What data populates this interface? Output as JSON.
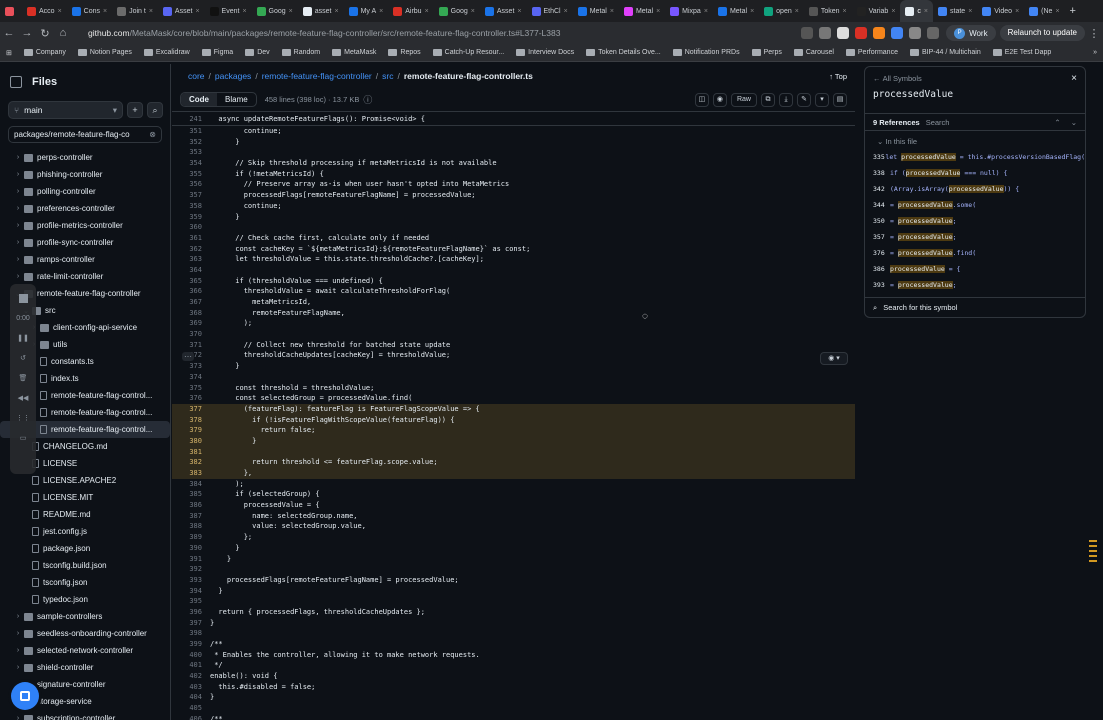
{
  "browser": {
    "tabs": [
      {
        "label": "",
        "color": "#e9505a"
      },
      {
        "label": "Acco",
        "color": "#d93025"
      },
      {
        "label": "Cons",
        "color": "#1a73e8"
      },
      {
        "label": "Join t",
        "color": "#6b6b6b"
      },
      {
        "label": "Asset",
        "color": "#5865f2"
      },
      {
        "label": "Event",
        "color": "#111"
      },
      {
        "label": "Goog",
        "color": "#34a853"
      },
      {
        "label": "asset",
        "color": "#e6edf3"
      },
      {
        "label": "My A",
        "color": "#1a73e8"
      },
      {
        "label": "Airbu",
        "color": "#d93025"
      },
      {
        "label": "Goog",
        "color": "#34a853"
      },
      {
        "label": "Asset",
        "color": "#1a73e8"
      },
      {
        "label": "EthCl",
        "color": "#5865f2"
      },
      {
        "label": "Metal",
        "color": "#1a73e8"
      },
      {
        "label": "Metal",
        "color": "#e040fb"
      },
      {
        "label": "Mixpa",
        "color": "#7856ff"
      },
      {
        "label": "Metal",
        "color": "#1a73e8"
      },
      {
        "label": "open",
        "color": "#10a37f"
      },
      {
        "label": "Token",
        "color": "#555"
      },
      {
        "label": "Variab",
        "color": "#222"
      },
      {
        "label": "c",
        "color": "#e6edf3",
        "active": true
      },
      {
        "label": "state",
        "color": "#4285f4"
      },
      {
        "label": "Video",
        "color": "#4285f4"
      },
      {
        "label": "(Ne",
        "color": "#4285f4"
      }
    ],
    "new_tab": "+",
    "url_host": "github.com",
    "url_path": "/MetaMask/core/blob/main/packages/remote-feature-flag-controller/src/remote-feature-flag-controller.ts#L377-L383",
    "profile_label": "Work",
    "profile_initial": "P",
    "relaunch_label": "Relaunch to update",
    "bookmarks": [
      "Company",
      "Notion Pages",
      "Excalidraw",
      "Figma",
      "Dev",
      "Random",
      "MetaMask",
      "Repos",
      "Catch-Up Resour...",
      "Interview Docs",
      "Token Details Ove...",
      "Notification PRDs",
      "Perps",
      "Carousel",
      "Performance",
      "BIP-44 / Multichain",
      "E2E Test Dapp"
    ],
    "bookmarks_more": "»"
  },
  "sidebar": {
    "title": "Files",
    "branch": "main",
    "filter_value": "packages/remote-feature-flag-co",
    "tree": [
      {
        "label": "perps-controller",
        "kind": "dir",
        "indent": 0,
        "chev": "›"
      },
      {
        "label": "phishing-controller",
        "kind": "dir",
        "indent": 0,
        "chev": "›"
      },
      {
        "label": "polling-controller",
        "kind": "dir",
        "indent": 0,
        "chev": "›"
      },
      {
        "label": "preferences-controller",
        "kind": "dir",
        "indent": 0,
        "chev": "›"
      },
      {
        "label": "profile-metrics-controller",
        "kind": "dir",
        "indent": 0,
        "chev": "›"
      },
      {
        "label": "profile-sync-controller",
        "kind": "dir",
        "indent": 0,
        "chev": "›"
      },
      {
        "label": "ramps-controller",
        "kind": "dir",
        "indent": 0,
        "chev": "›"
      },
      {
        "label": "rate-limit-controller",
        "kind": "dir",
        "indent": 0,
        "chev": "›"
      },
      {
        "label": "remote-feature-flag-controller",
        "kind": "dir",
        "indent": 0,
        "chev": "⌄"
      },
      {
        "label": "src",
        "kind": "dir",
        "indent": 1,
        "chev": "⌄"
      },
      {
        "label": "client-config-api-service",
        "kind": "dir",
        "indent": 2,
        "chev": "›"
      },
      {
        "label": "utils",
        "kind": "dir",
        "indent": 2,
        "chev": "›"
      },
      {
        "label": "constants.ts",
        "kind": "file",
        "indent": 2,
        "chev": ""
      },
      {
        "label": "index.ts",
        "kind": "file",
        "indent": 2,
        "chev": ""
      },
      {
        "label": "remote-feature-flag-control...",
        "kind": "file",
        "indent": 2,
        "chev": ""
      },
      {
        "label": "remote-feature-flag-control...",
        "kind": "file",
        "indent": 2,
        "chev": ""
      },
      {
        "label": "remote-feature-flag-control...",
        "kind": "file",
        "indent": 2,
        "chev": "",
        "selected": true
      },
      {
        "label": "CHANGELOG.md",
        "kind": "file",
        "indent": 1,
        "chev": ""
      },
      {
        "label": "LICENSE",
        "kind": "file",
        "indent": 1,
        "chev": ""
      },
      {
        "label": "LICENSE.APACHE2",
        "kind": "file",
        "indent": 1,
        "chev": ""
      },
      {
        "label": "LICENSE.MIT",
        "kind": "file",
        "indent": 1,
        "chev": ""
      },
      {
        "label": "README.md",
        "kind": "file",
        "indent": 1,
        "chev": ""
      },
      {
        "label": "jest.config.js",
        "kind": "file",
        "indent": 1,
        "chev": ""
      },
      {
        "label": "package.json",
        "kind": "file",
        "indent": 1,
        "chev": ""
      },
      {
        "label": "tsconfig.build.json",
        "kind": "file",
        "indent": 1,
        "chev": ""
      },
      {
        "label": "tsconfig.json",
        "kind": "file",
        "indent": 1,
        "chev": ""
      },
      {
        "label": "typedoc.json",
        "kind": "file",
        "indent": 1,
        "chev": ""
      },
      {
        "label": "sample-controllers",
        "kind": "dir",
        "indent": 0,
        "chev": "›"
      },
      {
        "label": "seedless-onboarding-controller",
        "kind": "dir",
        "indent": 0,
        "chev": "›"
      },
      {
        "label": "selected-network-controller",
        "kind": "dir",
        "indent": 0,
        "chev": "›"
      },
      {
        "label": "shield-controller",
        "kind": "dir",
        "indent": 0,
        "chev": "›"
      },
      {
        "label": "signature-controller",
        "kind": "dir",
        "indent": 0,
        "chev": "›"
      },
      {
        "label": "storage-service",
        "kind": "dir",
        "indent": 0,
        "chev": "›"
      },
      {
        "label": "subscription-controller",
        "kind": "dir",
        "indent": 0,
        "chev": "›"
      }
    ],
    "video_timer": "0:00"
  },
  "main": {
    "breadcrumbs": [
      "core",
      "packages",
      "remote-feature-flag-controller",
      "src"
    ],
    "current_file": "remote-feature-flag-controller.ts",
    "top_label": "Top",
    "tab_code": "Code",
    "tab_blame": "Blame",
    "file_meta": "458 lines (398 loc) · 13.7 KB",
    "raw_label": "Raw",
    "sticky": {
      "num": "241",
      "text": "  async updateRemoteFeatureFlags(): Promise<void> {"
    },
    "lines": [
      {
        "num": "351",
        "text": "        continue;"
      },
      {
        "num": "352",
        "text": "      }"
      },
      {
        "num": "353",
        "text": ""
      },
      {
        "num": "354",
        "text": "      // Skip threshold processing if metaMetricsId is not available"
      },
      {
        "num": "355",
        "text": "      if (!metaMetricsId) {"
      },
      {
        "num": "356",
        "text": "        // Preserve array as-is when user hasn't opted into MetaMetrics"
      },
      {
        "num": "357",
        "text": "        processedFlags[remoteFeatureFlagName] = processedValue;"
      },
      {
        "num": "358",
        "text": "        continue;"
      },
      {
        "num": "359",
        "text": "      }"
      },
      {
        "num": "360",
        "text": ""
      },
      {
        "num": "361",
        "text": "      // Check cache first, calculate only if needed"
      },
      {
        "num": "362",
        "text": "      const cacheKey = `${metaMetricsId}:${remoteFeatureFlagName}` as const;"
      },
      {
        "num": "363",
        "text": "      let thresholdValue = this.state.thresholdCache?.[cacheKey];"
      },
      {
        "num": "364",
        "text": ""
      },
      {
        "num": "365",
        "text": "      if (thresholdValue === undefined) {"
      },
      {
        "num": "366",
        "text": "        thresholdValue = await calculateThresholdForFlag("
      },
      {
        "num": "367",
        "text": "          metaMetricsId,"
      },
      {
        "num": "368",
        "text": "          remoteFeatureFlagName,"
      },
      {
        "num": "369",
        "text": "        );"
      },
      {
        "num": "370",
        "text": ""
      },
      {
        "num": "371",
        "text": "        // Collect new threshold for batched state update"
      },
      {
        "num": "372",
        "text": "        thresholdCacheUpdates[cacheKey] = thresholdValue;"
      },
      {
        "num": "373",
        "text": "      }"
      },
      {
        "num": "374",
        "text": ""
      },
      {
        "num": "375",
        "text": "      const threshold = thresholdValue;"
      },
      {
        "num": "376",
        "text": "      const selectedGroup = processedValue.find("
      },
      {
        "num": "377",
        "text": "        (featureFlag): featureFlag is FeatureFlagScopeValue => {",
        "hl": true
      },
      {
        "num": "378",
        "text": "          if (!isFeatureFlagWithScopeValue(featureFlag)) {",
        "hl": true
      },
      {
        "num": "379",
        "text": "            return false;",
        "hl": true
      },
      {
        "num": "380",
        "text": "          }",
        "hl": true
      },
      {
        "num": "381",
        "text": "",
        "hl": true
      },
      {
        "num": "382",
        "text": "          return threshold <= featureFlag.scope.value;",
        "hl": true
      },
      {
        "num": "383",
        "text": "        },",
        "hl": true
      },
      {
        "num": "384",
        "text": "      );"
      },
      {
        "num": "385",
        "text": "      if (selectedGroup) {"
      },
      {
        "num": "386",
        "text": "        processedValue = {"
      },
      {
        "num": "387",
        "text": "          name: selectedGroup.name,"
      },
      {
        "num": "388",
        "text": "          value: selectedGroup.value,"
      },
      {
        "num": "389",
        "text": "        };"
      },
      {
        "num": "390",
        "text": "      }"
      },
      {
        "num": "391",
        "text": "    }"
      },
      {
        "num": "392",
        "text": ""
      },
      {
        "num": "393",
        "text": "    processedFlags[remoteFeatureFlagName] = processedValue;"
      },
      {
        "num": "394",
        "text": "  }"
      },
      {
        "num": "395",
        "text": ""
      },
      {
        "num": "396",
        "text": "  return { processedFlags, thresholdCacheUpdates };"
      },
      {
        "num": "397",
        "text": "}"
      },
      {
        "num": "398",
        "text": ""
      },
      {
        "num": "399",
        "text": "/**"
      },
      {
        "num": "400",
        "text": " * Enables the controller, allowing it to make network requests."
      },
      {
        "num": "401",
        "text": " */"
      },
      {
        "num": "402",
        "text": "enable(): void {"
      },
      {
        "num": "403",
        "text": "  this.#disabled = false;"
      },
      {
        "num": "404",
        "text": "}"
      },
      {
        "num": "405",
        "text": ""
      },
      {
        "num": "406",
        "text": "/**"
      }
    ],
    "line_dots": "⋯"
  },
  "symbols": {
    "header": "All Symbols",
    "name": "processedValue",
    "ref_count": "9 References",
    "search_placeholder": "Search",
    "in_file": "In this file",
    "refs": [
      {
        "num": "335",
        "pre": "let ",
        "sym": "processedValue",
        "post": " = this.#processVersionBasedFlag("
      },
      {
        "num": "338",
        "pre": "if (",
        "sym": "processedValue",
        "post": " === null) {"
      },
      {
        "num": "342",
        "pre": "(Array.isArray(",
        "sym": "processedValue",
        "post": ")) {"
      },
      {
        "num": "344",
        "pre": "= ",
        "sym": "processedValue",
        "post": ".some("
      },
      {
        "num": "350",
        "pre": "= ",
        "sym": "processedValue",
        "post": ";"
      },
      {
        "num": "357",
        "pre": "= ",
        "sym": "processedValue",
        "post": ";"
      },
      {
        "num": "376",
        "pre": "= ",
        "sym": "processedValue",
        "post": ".find("
      },
      {
        "num": "386",
        "pre": "",
        "sym": "processedValue",
        "post": " = {"
      },
      {
        "num": "393",
        "pre": "= ",
        "sym": "processedValue",
        "post": ";"
      }
    ],
    "search_symbol": "Search for this symbol"
  },
  "colors": {
    "accent": "#2f81f7",
    "highlight": "#2f2a1c",
    "symbol_mark": "#4d3a11"
  }
}
